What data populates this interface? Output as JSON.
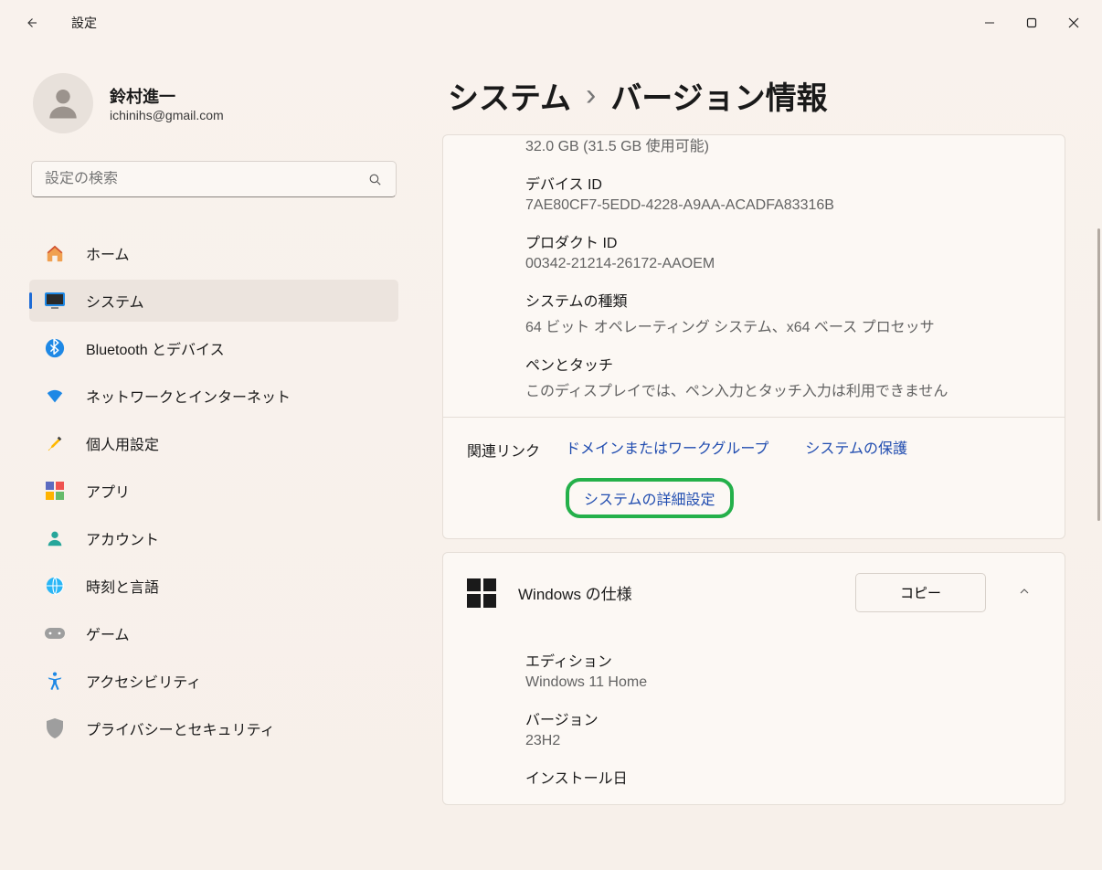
{
  "titlebar": {
    "title": "設定"
  },
  "profile": {
    "name": "鈴村進一",
    "email": "ichinihs@gmail.com"
  },
  "search": {
    "placeholder": "設定の検索"
  },
  "nav": {
    "items": [
      {
        "label": "ホーム"
      },
      {
        "label": "システム"
      },
      {
        "label": "Bluetooth とデバイス"
      },
      {
        "label": "ネットワークとインターネット"
      },
      {
        "label": "個人用設定"
      },
      {
        "label": "アプリ"
      },
      {
        "label": "アカウント"
      },
      {
        "label": "時刻と言語"
      },
      {
        "label": "ゲーム"
      },
      {
        "label": "アクセシビリティ"
      },
      {
        "label": "プライバシーとセキュリティ"
      }
    ]
  },
  "breadcrumb": {
    "section": "システム",
    "page": "バージョン情報"
  },
  "device_spec": {
    "ram_peek": "32.0 GB (31.5 GB 使用可能)",
    "device_id_label": "デバイス ID",
    "device_id": "7AE80CF7-5EDD-4228-A9AA-ACADFA83316B",
    "product_id_label": "プロダクト ID",
    "product_id": "00342-21214-26172-AAOEM",
    "system_type_label": "システムの種類",
    "system_type": "64 ビット オペレーティング システム、x64 ベース プロセッサ",
    "pen_touch_label": "ペンとタッチ",
    "pen_touch": "このディスプレイでは、ペン入力とタッチ入力は利用できません"
  },
  "related": {
    "label": "関連リンク",
    "domain_workgroup": "ドメインまたはワークグループ",
    "system_protection": "システムの保護",
    "advanced_settings": "システムの詳細設定"
  },
  "windows_spec": {
    "header": "Windows の仕様",
    "copy": "コピー",
    "edition_label": "エディション",
    "edition": "Windows 11 Home",
    "version_label": "バージョン",
    "version": "23H2",
    "install_date_label": "インストール日"
  }
}
